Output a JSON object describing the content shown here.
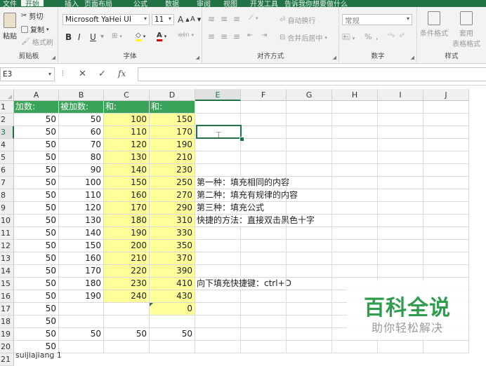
{
  "tabs": [
    "文件",
    "开始",
    "插入",
    "页面布局",
    "公式",
    "数据",
    "审阅",
    "视图",
    "开发工具",
    "告诉我你想要做什么"
  ],
  "active_tab": "开始",
  "ribbon": {
    "clipboard": {
      "paste": "粘贴",
      "cut": "剪切",
      "copy": "复制",
      "format_painter": "格式刷",
      "label": "剪贴板"
    },
    "font": {
      "name": "Microsoft YaHei UI",
      "size": "11",
      "grow": "A",
      "shrink": "A",
      "bold": "B",
      "italic": "I",
      "underline": "U",
      "font_color_glyph": "A",
      "phonetic": "wén",
      "label": "字体"
    },
    "alignment": {
      "wrap": "自动换行",
      "merge": "合并后居中",
      "label": "对齐方式"
    },
    "number": {
      "format": "常规",
      "percent": "%",
      "comma": ",",
      "label": "数字"
    },
    "styles": {
      "conditional": "条件格式",
      "table": "套用\n表格格式",
      "label": "样式"
    }
  },
  "formula_bar": {
    "name_box": "E3",
    "cancel": "✕",
    "enter": "✓",
    "fx": "fx",
    "value": ""
  },
  "columns": [
    "A",
    "B",
    "C",
    "D",
    "E",
    "F",
    "G",
    "H",
    "I",
    "J"
  ],
  "selected_column": "E",
  "rows": [
    "1",
    "2",
    "3",
    "4",
    "5",
    "6",
    "7",
    "8",
    "9",
    "10",
    "11",
    "12",
    "13",
    "14",
    "15",
    "16",
    "17",
    "18",
    "19",
    "20",
    "21"
  ],
  "selected_row": "3",
  "cells": {
    "A": [
      "加数:",
      "50",
      "50",
      "50",
      "50",
      "50",
      "50",
      "50",
      "50",
      "50",
      "50",
      "50",
      "50",
      "50",
      "50",
      "50",
      "50",
      "50",
      "50",
      "50"
    ],
    "B": [
      "被加数:",
      "50",
      "60",
      "70",
      "80",
      "90",
      "100",
      "110",
      "120",
      "130",
      "140",
      "150",
      "160",
      "170",
      "180",
      "190",
      "",
      "",
      "50",
      ""
    ],
    "C": [
      "和:",
      "100",
      "110",
      "120",
      "130",
      "140",
      "150",
      "160",
      "170",
      "180",
      "190",
      "200",
      "210",
      "220",
      "230",
      "240",
      "",
      "",
      "50",
      ""
    ],
    "D": [
      "和:",
      "150",
      "170",
      "190",
      "210",
      "230",
      "250",
      "270",
      "290",
      "310",
      "330",
      "350",
      "370",
      "390",
      "410",
      "430",
      "0",
      "",
      "50",
      ""
    ]
  },
  "notes": {
    "r7": "第一种：填充相同的内容",
    "r8": "第二种：填充有规律的内容",
    "r9": "第三种：填充公式",
    "r10": "快捷的方法：直接双击黑色十字",
    "r15": "向下填充快捷键：ctrl+D"
  },
  "sheet_tab": "suijiajiang 1",
  "watermark": {
    "title": "百科全说",
    "subtitle": "助你轻松解决"
  },
  "colors": {
    "excel_green": "#217346",
    "header_fill": "#3aa35a",
    "sum_fill": "#ffff99",
    "watermark_green": "#2f9d4e"
  }
}
